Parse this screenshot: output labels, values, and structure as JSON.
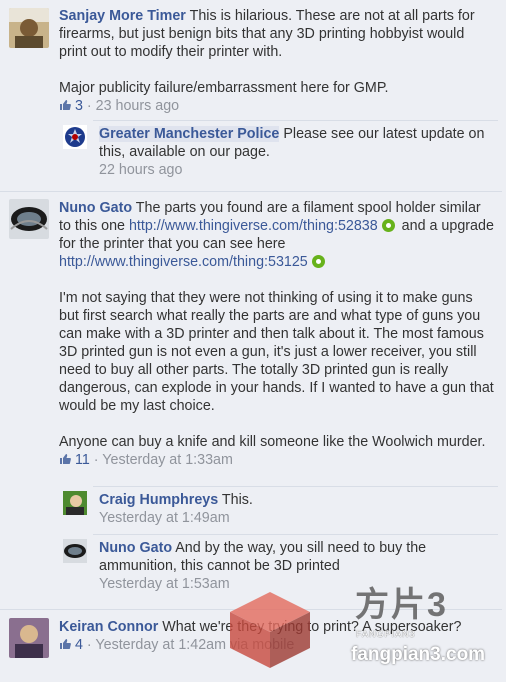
{
  "comments": [
    {
      "author": "Sanjay More Timer",
      "text1": " This is hilarious. These are not at all parts for firearms, but just benign bits that any 3D printing hobbyist would print out to modify their printer with.",
      "text2": "Major publicity failure/embarrassment here for GMP.",
      "likes": "3",
      "time": "23 hours ago",
      "replies": [
        {
          "author": "Greater Manchester Police",
          "text": " Please see our latest update on this, available on our page.",
          "time": "22 hours ago"
        }
      ]
    },
    {
      "author": "Nuno Gato",
      "text1": " The parts you found are a filament spool holder similar to this one ",
      "link1": "http://www.thingiverse.com/thing:52838",
      "text1b": " and a upgrade for the printer that you can see here",
      "link2": "http://www.thingiverse.com/thing:53125",
      "text2": "I'm not saying that they were not thinking of using it to make guns but first search what really the parts are and what type of guns you can make with a 3D printer and then talk about it. The most famous 3D printed gun is not even a gun, it's just a lower receiver, you still need to buy all other parts. The totally 3D printed gun is really dangerous, can explode in your hands. If I wanted to have a gun that would be my last choice.",
      "text3": "Anyone can buy a knife and kill someone like the Woolwich murder.",
      "likes": "11",
      "time": "Yesterday at 1:33am",
      "replies": [
        {
          "author": "Craig Humphreys",
          "text": " This.",
          "time": "Yesterday at 1:49am"
        },
        {
          "author": "Nuno Gato",
          "text": " And by the way, you sill need to buy the ammunition, this cannot be 3D printed",
          "time": "Yesterday at 1:53am"
        }
      ]
    },
    {
      "author": "Keiran Connor",
      "text1": " What we're they trying to print? A supersoaker?",
      "likes": "4",
      "time": "Yesterday at 1:42am via mobile"
    }
  ],
  "meta_sep": " · ",
  "watermark": {
    "cn": "方片3",
    "site": "fangpian3.com",
    "sub": "FANGPIAN3"
  },
  "colors": {
    "link": "#3b5998",
    "background": "#edeff4",
    "meta": "#90949c"
  }
}
